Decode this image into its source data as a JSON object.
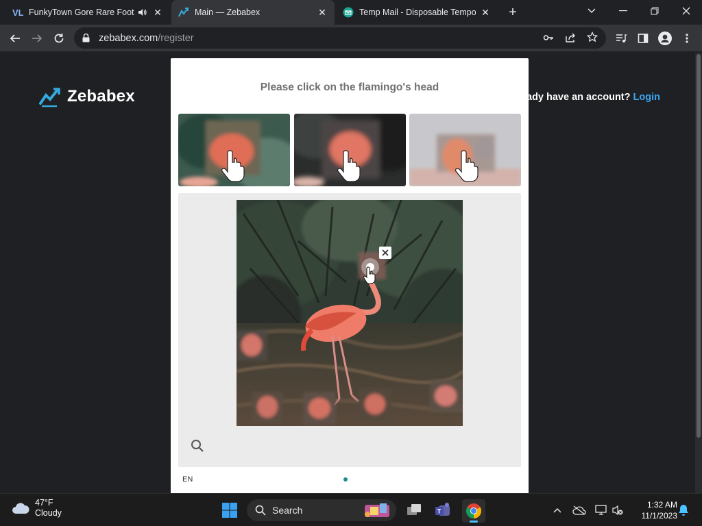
{
  "browser": {
    "tabs": [
      {
        "title": "FunkyTown Gore Rare Footage",
        "favicon": "vl-logo-icon",
        "audio": true,
        "active": false
      },
      {
        "title": "Main — Zebabex",
        "favicon": "zebabex-icon",
        "active": true
      },
      {
        "title": "Temp Mail - Disposable Temporary Email",
        "favicon": "temp-mail-icon",
        "active": false
      }
    ],
    "address": {
      "host": "zebabex.com",
      "path": "/register"
    }
  },
  "page": {
    "brand": "Zebabex",
    "account_prompt": "ady have an account?",
    "login_link": "Login",
    "accent_color": "#3aa5f0"
  },
  "captcha": {
    "prompt": "Please click on the flamingo's head",
    "language": "EN",
    "examples_count": 3,
    "selected_marker": true
  },
  "taskbar": {
    "weather": {
      "temp": "47°F",
      "condition": "Cloudy"
    },
    "search_placeholder": "Search",
    "time": "1:32 AM",
    "date": "11/1/2023"
  }
}
